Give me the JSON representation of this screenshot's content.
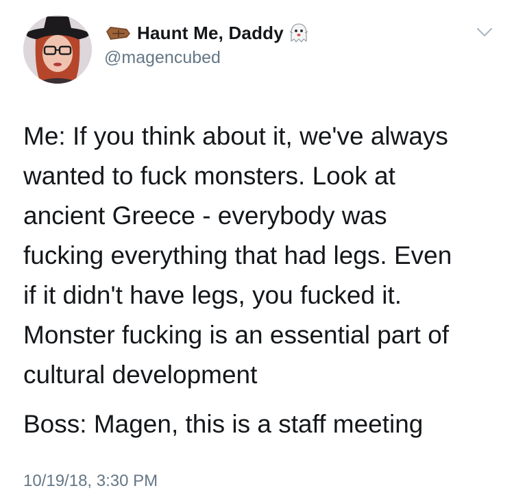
{
  "tweet": {
    "author": {
      "display_name": "Haunt Me, Daddy",
      "handle": "@magencubed",
      "name_prefix_icon": "coffin-icon",
      "name_suffix_icon": "ghost-icon",
      "avatar_icon": "profile-avatar"
    },
    "menu_icon": "chevron-down-icon",
    "paragraphs": [
      "Me: If you think about it, we've always\nwanted to fuck monsters. Look at\nancient Greece - everybody was\nfucking everything that had legs. Even\nif it didn't have legs, you fucked it.\nMonster fucking is an essential part of\ncultural development",
      "Boss: Magen, this is a staff meeting"
    ],
    "timestamp": "10/19/18, 3:30 PM"
  },
  "colors": {
    "text_primary": "#14171a",
    "text_secondary": "#657786",
    "background": "#ffffff"
  }
}
